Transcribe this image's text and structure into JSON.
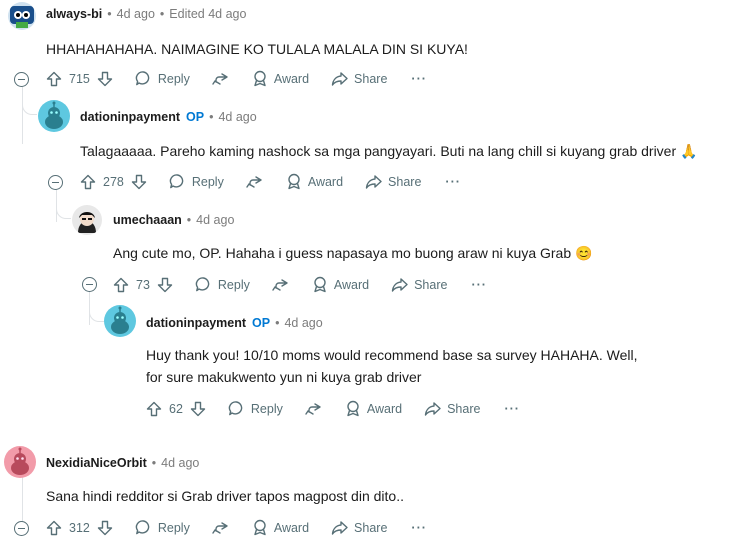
{
  "comments": [
    {
      "author": "always-bi",
      "op": "",
      "time": "4d ago",
      "edited": "Edited 4d ago",
      "body": "HHAHAHAHAHA. NAIMAGINE KO TULALA MALALA DIN SI KUYA!",
      "votes": "715"
    },
    {
      "author": "dationinpayment",
      "op": "OP",
      "time": "4d ago",
      "edited": "",
      "body": "Talagaaaaa. Pareho kaming nashock sa mga pangyayari. Buti na lang chill si kuyang grab driver 🙏",
      "votes": "278"
    },
    {
      "author": "umechaaan",
      "op": "",
      "time": "4d ago",
      "edited": "",
      "body": "Ang cute mo, OP. Hahaha i guess napasaya mo buong araw ni kuya Grab 😊",
      "votes": "73"
    },
    {
      "author": "dationinpayment",
      "op": "OP",
      "time": "4d ago",
      "edited": "",
      "body": "Huy thank you! 10/10 moms would recommend base sa survey HAHAHA. Well, for sure makukwento yun ni kuya grab driver",
      "votes": "62"
    },
    {
      "author": "NexidiaNiceOrbit",
      "op": "",
      "time": "4d ago",
      "edited": "",
      "body": "Sana hindi redditor si Grab driver tapos magpost din dito..",
      "votes": "312"
    }
  ],
  "actions": {
    "reply": "Reply",
    "award": "Award",
    "share": "Share",
    "more": "···"
  },
  "colors": {
    "accent": "#0079d3",
    "meta": "#7c7c7c",
    "action": "#576f76",
    "thread_line": "#e0e3e6"
  }
}
